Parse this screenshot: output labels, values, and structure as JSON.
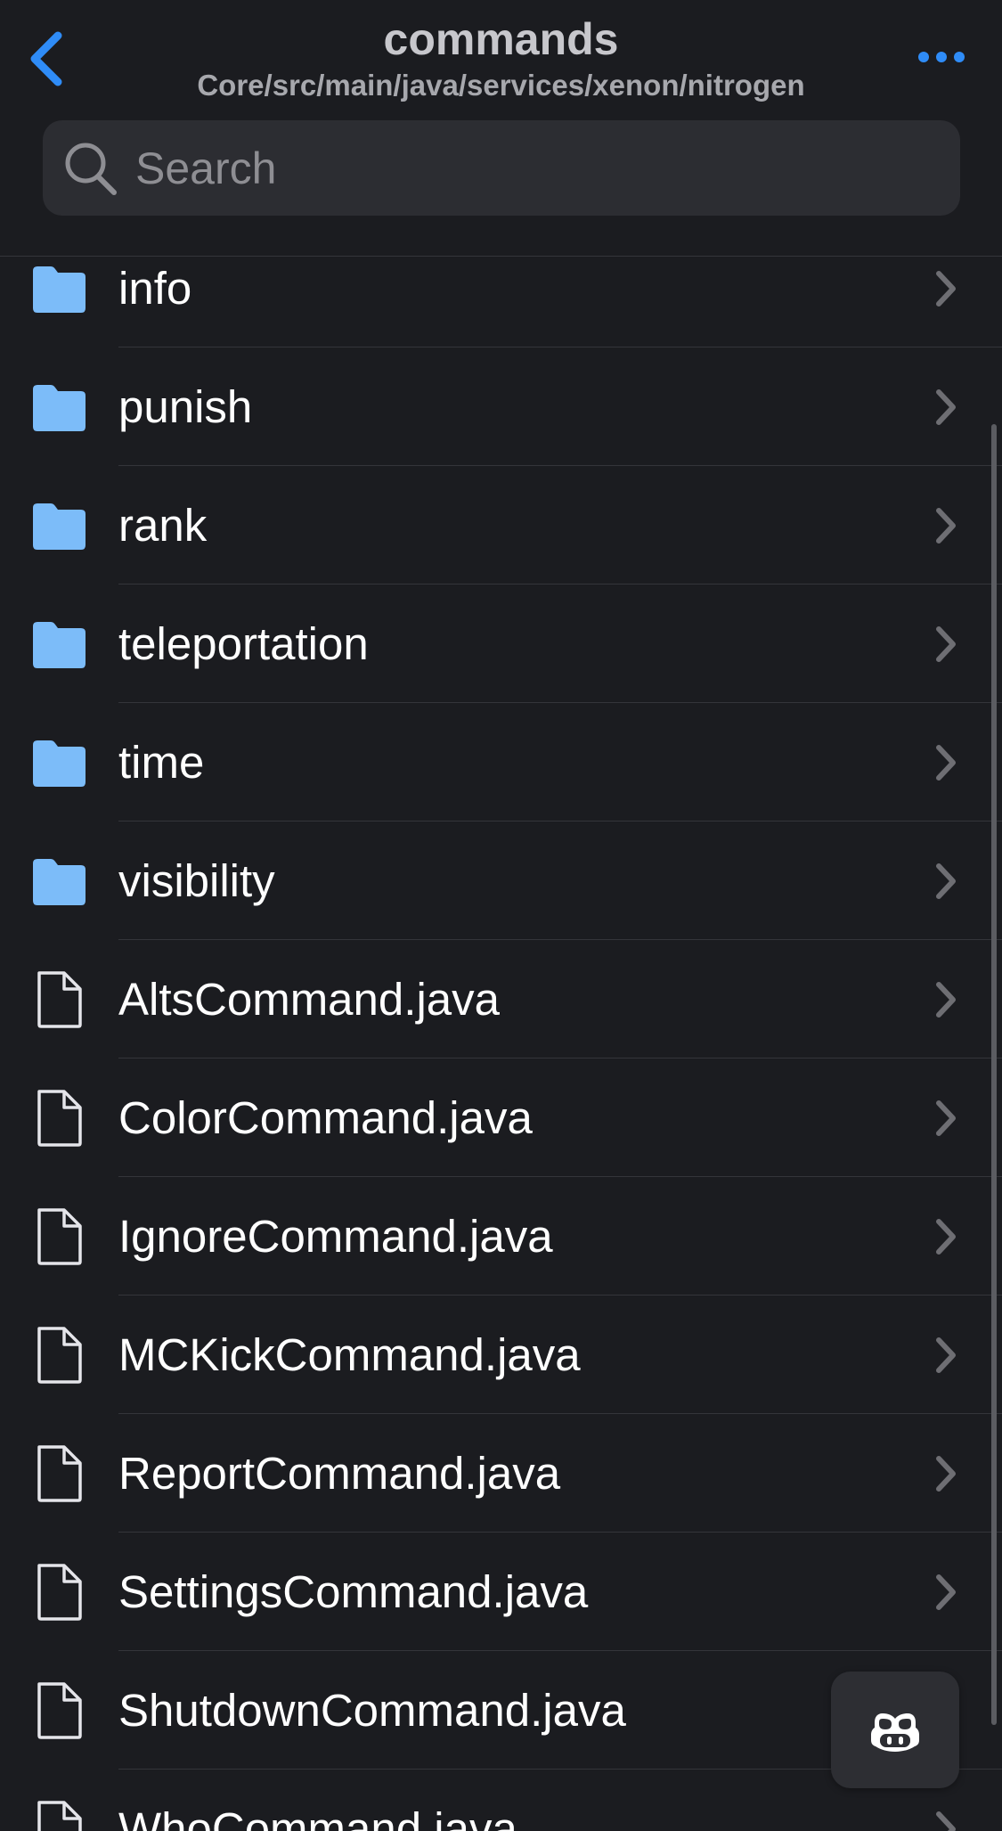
{
  "header": {
    "title": "commands",
    "path": "Core/src/main/java/services/xenon/nitrogen",
    "back_icon": "chevron-left-icon",
    "more_icon": "ellipsis-icon",
    "accent_color": "#2f8cf7"
  },
  "search": {
    "placeholder": "Search",
    "value": "",
    "icon": "search-icon"
  },
  "entries": [
    {
      "type": "folder",
      "name": "info",
      "icon": "folder-icon"
    },
    {
      "type": "folder",
      "name": "punish",
      "icon": "folder-icon"
    },
    {
      "type": "folder",
      "name": "rank",
      "icon": "folder-icon"
    },
    {
      "type": "folder",
      "name": "teleportation",
      "icon": "folder-icon"
    },
    {
      "type": "folder",
      "name": "time",
      "icon": "folder-icon"
    },
    {
      "type": "folder",
      "name": "visibility",
      "icon": "folder-icon"
    },
    {
      "type": "file",
      "name": "AltsCommand.java",
      "icon": "file-icon"
    },
    {
      "type": "file",
      "name": "ColorCommand.java",
      "icon": "file-icon"
    },
    {
      "type": "file",
      "name": "IgnoreCommand.java",
      "icon": "file-icon"
    },
    {
      "type": "file",
      "name": "MCKickCommand.java",
      "icon": "file-icon"
    },
    {
      "type": "file",
      "name": "ReportCommand.java",
      "icon": "file-icon"
    },
    {
      "type": "file",
      "name": "SettingsCommand.java",
      "icon": "file-icon"
    },
    {
      "type": "file",
      "name": "ShutdownCommand.java",
      "icon": "file-icon"
    },
    {
      "type": "file",
      "name": "WhoCommand.java",
      "icon": "file-icon"
    }
  ],
  "floating_button": {
    "icon": "copilot-icon"
  },
  "colors": {
    "background": "#1b1c20",
    "folder": "#7cbcf9",
    "file_outline": "#e5e5ea",
    "chevron": "#6e6e73",
    "separator": "#34353a"
  }
}
